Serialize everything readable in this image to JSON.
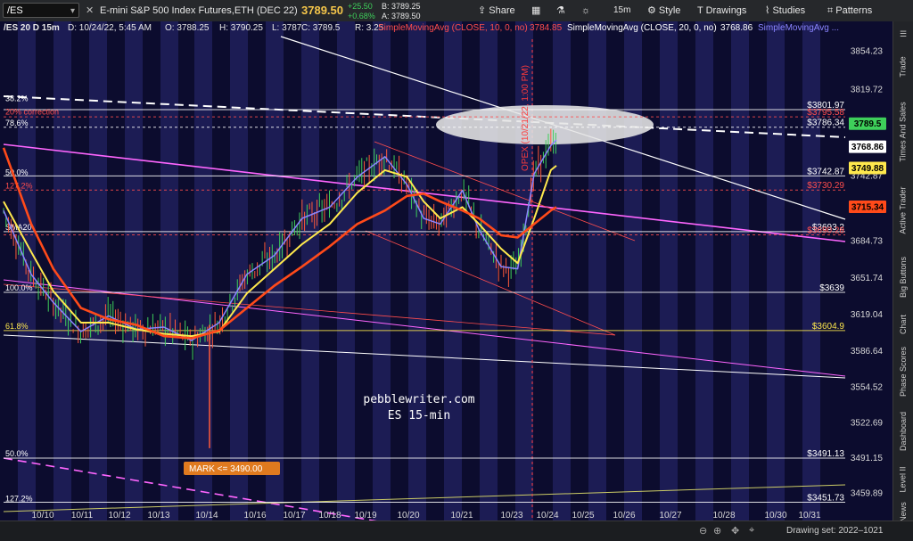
{
  "toolbar": {
    "symbol": "/ES",
    "description": "E-mini S&P 500 Index Futures,ETH (DEC 22)",
    "last": "3789.50",
    "change": "+25.50",
    "change_pct": "+0.68%",
    "bid": "B: 3789.25",
    "ask": "A: 3789.50",
    "share": "Share",
    "timeframe": "15m",
    "style": "Style",
    "drawings": "Drawings",
    "studies": "Studies",
    "patterns": "Patterns"
  },
  "info": {
    "title": "/ES 20 D 15m",
    "date": "D: 10/24/22, 5:45 AM",
    "open": "O: 3788.25",
    "high": "H: 3790.25",
    "low": "L: 3787",
    "close": "C: 3789.5",
    "range": "R: 3.25",
    "sma10_label": "SimpleMovingAvg (CLOSE, 10, 0, no)",
    "sma10_value": "3784.85",
    "sma20_label": "SimpleMovingAvg (CLOSE, 20, 0, no)",
    "sma20_value": "3768.86",
    "sma3_label": "SimpleMovingAvg ..."
  },
  "sidebar": {
    "trade": "Trade",
    "tabs": [
      "Times And Sales",
      "Active Trader",
      "Big Buttons",
      "Chart",
      "Phase Scores",
      "Dashboard",
      "Level II",
      "Live News"
    ]
  },
  "bottom": {
    "drawing_set": "Drawing set: 2022–1021"
  },
  "colors": {
    "background": "#0c0c2e",
    "band": "#1c1c54",
    "sma10": "#ffe94d",
    "sma20": "#ff4a1a",
    "sma5": "#8a84ff",
    "fib": "#ff66ff",
    "accent_up": "#3ecf5a"
  },
  "chart_data": {
    "type": "line",
    "title": "/ES 20 D 15m",
    "y_ticks": [
      "3854.23",
      "3819.72",
      "3786.34",
      "3768.86",
      "3742.87",
      "3715.34",
      "3684.73",
      "3651.74",
      "3619.04",
      "3586.64",
      "3554.52",
      "3522.69",
      "3491.15",
      "3459.89"
    ],
    "x_ticks": [
      "10/10",
      "10/11",
      "10/12",
      "10/13",
      "10/14",
      "10/16",
      "10/17",
      "10/18",
      "10/19",
      "10/20",
      "10/21",
      "10/23",
      "10/24",
      "10/25",
      "10/26",
      "10/27",
      "10/28",
      "10/30",
      "10/31"
    ],
    "fib_labels": [
      {
        "text": "38.2%",
        "value": 3808
      },
      {
        "text": "20% correction",
        "value": 3796,
        "color": "red"
      },
      {
        "text": "78.6%",
        "value": 3786
      },
      {
        "text": "50.0%",
        "value": 3742
      },
      {
        "text": "127.2%",
        "value": 3730,
        "color": "red"
      },
      {
        "text": "SMA20",
        "value": 3693
      },
      {
        "text": "100.0%",
        "value": 3639
      },
      {
        "text": "61.8%",
        "value": 3605,
        "color": "yellow"
      },
      {
        "text": "50.0%",
        "value": 3491
      },
      {
        "text": "127.2%",
        "value": 3451
      }
    ],
    "price_levels": [
      {
        "text": "$3801.97",
        "value": 3801.97
      },
      {
        "text": "$3795.58",
        "value": 3795.58,
        "color": "red"
      },
      {
        "text": "$3786.34",
        "value": 3786.34
      },
      {
        "text": "$3742.87",
        "value": 3742.87
      },
      {
        "text": "$3730.29",
        "value": 3730.29,
        "color": "red"
      },
      {
        "text": "$3693.2",
        "value": 3693.2
      },
      {
        "text": "$3690.28",
        "value": 3690.28,
        "color": "red"
      },
      {
        "text": "$3639",
        "value": 3639
      },
      {
        "text": "$3604.9",
        "value": 3604.9,
        "color": "yellow"
      },
      {
        "text": "$3491.13",
        "value": 3491.13
      },
      {
        "text": "$3451.73",
        "value": 3451.73
      }
    ],
    "price_badges": [
      {
        "text": "3789.5",
        "value": 3789.5,
        "color": "#3ecf5a"
      },
      {
        "text": "3768.86",
        "value": 3768.86,
        "color": "#ffffff"
      },
      {
        "text": "3749.88",
        "value": 3749.88,
        "color": "#ffe94d"
      },
      {
        "text": "3715.34",
        "value": 3715.34,
        "color": "#ff4a1a"
      }
    ],
    "annotations": {
      "watermark_site": "pebblewriter.com",
      "watermark_label": "ES 15-min",
      "opex": "OPEX (10/21/22, 1:00 PM)",
      "mark": "MARK <= 3490.00"
    },
    "ylim": [
      3445,
      3868
    ],
    "series": [
      {
        "name": "SMA5",
        "x": [
          0,
          5,
          9,
          14,
          19,
          24,
          29,
          34,
          39,
          44,
          49,
          54,
          59,
          64,
          69,
          73,
          76,
          79,
          83,
          86,
          90,
          93,
          96,
          99,
          100
        ],
        "values": [
          3712,
          3655,
          3630,
          3604,
          3618,
          3606,
          3608,
          3596,
          3612,
          3655,
          3672,
          3705,
          3715,
          3742,
          3760,
          3735,
          3705,
          3700,
          3730,
          3695,
          3662,
          3660,
          3745,
          3770,
          3775
        ]
      },
      {
        "name": "SMA10",
        "x": [
          0,
          5,
          9,
          14,
          19,
          24,
          29,
          34,
          39,
          44,
          49,
          54,
          59,
          64,
          69,
          73,
          76,
          79,
          83,
          86,
          90,
          93,
          96,
          99,
          100
        ],
        "values": [
          3720,
          3675,
          3640,
          3612,
          3612,
          3606,
          3602,
          3600,
          3604,
          3638,
          3660,
          3682,
          3700,
          3728,
          3748,
          3742,
          3720,
          3705,
          3715,
          3700,
          3678,
          3665,
          3705,
          3748,
          3752
        ]
      },
      {
        "name": "SMA20",
        "x": [
          0,
          5,
          9,
          14,
          19,
          24,
          29,
          34,
          39,
          44,
          49,
          54,
          59,
          64,
          69,
          73,
          76,
          79,
          83,
          86,
          90,
          93,
          96,
          99,
          100
        ],
        "values": [
          3768,
          3700,
          3660,
          3625,
          3615,
          3610,
          3600,
          3598,
          3605,
          3625,
          3645,
          3662,
          3680,
          3700,
          3712,
          3725,
          3727,
          3720,
          3712,
          3705,
          3690,
          3688,
          3700,
          3712,
          3715
        ]
      }
    ]
  }
}
